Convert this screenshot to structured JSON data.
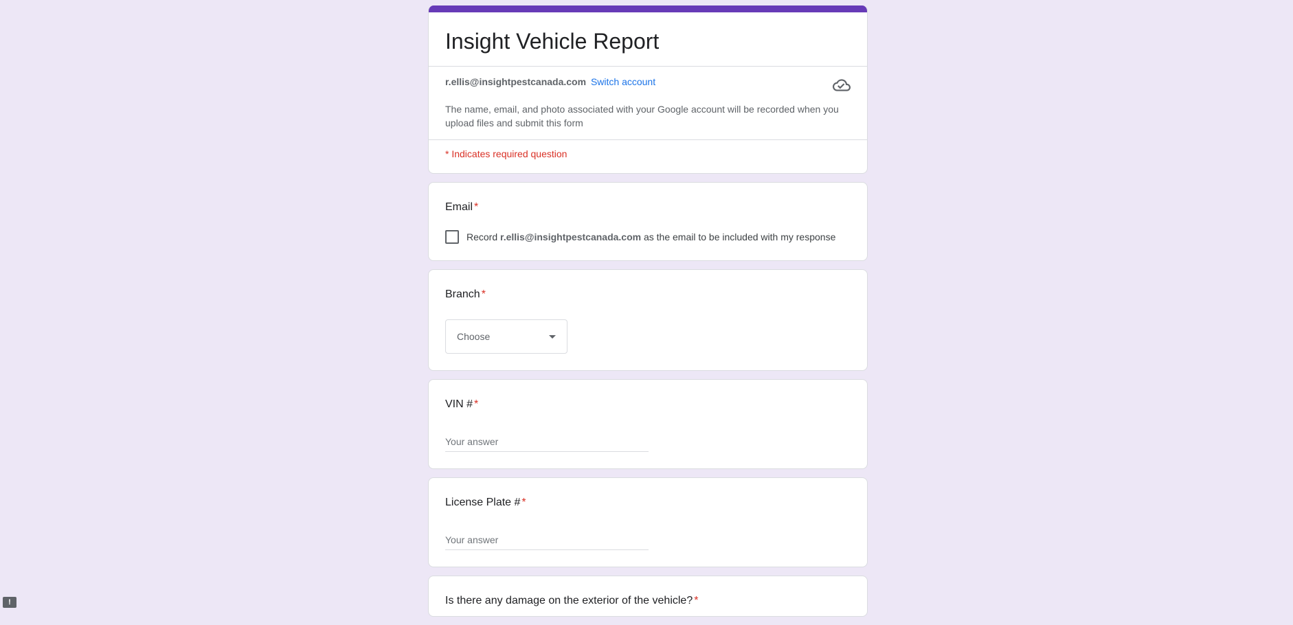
{
  "form": {
    "title": "Insight Vehicle Report",
    "accent_color": "#673ab7"
  },
  "account": {
    "email": "r.ellis@insightpestcanada.com",
    "switch_label": "Switch account",
    "note": "The name, email, and photo associated with your Google account will be recorded when you upload files and submit this form",
    "cloud_icon": "cloud-check-icon"
  },
  "required_note": "* Indicates required question",
  "questions": {
    "email": {
      "title": "Email",
      "star": "*",
      "checkbox_prefix": "Record",
      "checkbox_email": "r.ellis@insightpestcanada.com",
      "checkbox_suffix": "as the email to be included with my response"
    },
    "branch": {
      "title": "Branch",
      "star": "*",
      "select_value": "Choose"
    },
    "vin": {
      "title": "VIN #",
      "star": "*",
      "placeholder": "Your answer"
    },
    "license": {
      "title": "License Plate #",
      "star": "*",
      "placeholder": "Your answer"
    },
    "damage": {
      "title": "Is there any damage on the exterior of the vehicle?",
      "star": "*"
    }
  },
  "feedback": {
    "icon": "feedback-icon",
    "glyph": "!"
  }
}
